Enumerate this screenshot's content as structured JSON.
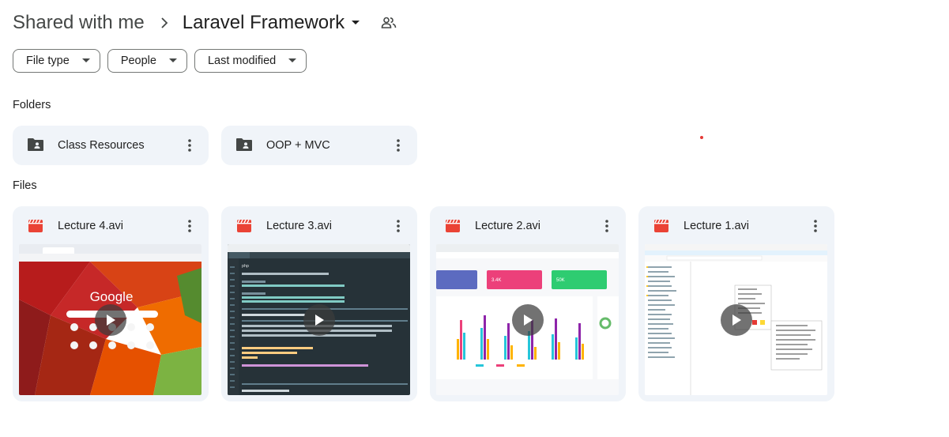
{
  "breadcrumb": {
    "root": "Shared with me",
    "current": "Laravel Framework"
  },
  "filters": [
    "File type",
    "People",
    "Last modified"
  ],
  "sections": {
    "folders": "Folders",
    "files": "Files"
  },
  "folders": [
    {
      "name": "Class Resources",
      "icon": "shared-folder-icon"
    },
    {
      "name": "OOP + MVC",
      "icon": "shared-folder-icon"
    }
  ],
  "files": [
    {
      "name": "Lecture 4.avi",
      "icon": "video-file-icon",
      "thumb": {
        "brand": "Google"
      }
    },
    {
      "name": "Lecture 3.avi",
      "icon": "video-file-icon",
      "thumb": {
        "lang": "php"
      }
    },
    {
      "name": "Lecture 2.avi",
      "icon": "video-file-icon",
      "thumb": {
        "stat1": "3.4K",
        "stat2": "50K"
      }
    },
    {
      "name": "Lecture 1.avi",
      "icon": "video-file-icon",
      "thumb": {}
    }
  ],
  "colors": {
    "card_bg": "#f0f4f9",
    "video_icon": "#ea4335",
    "chip_border": "#747775"
  }
}
